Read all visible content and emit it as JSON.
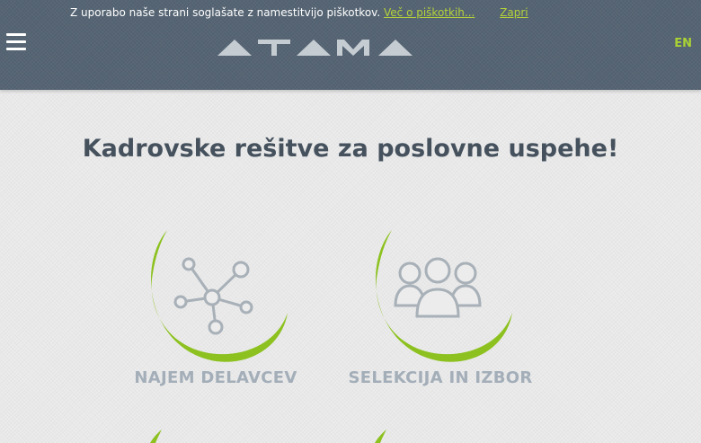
{
  "cookie_bar": {
    "text": "Z uporabo naše strani soglašate z namestitvijo piškotkov.",
    "more_link": "Več o piškotkih...",
    "close_link": "Zapri"
  },
  "header": {
    "lang": "EN",
    "logo_alt": "ATAMA"
  },
  "main": {
    "headline": "Kadrovske rešitve za poslovne uspehe!"
  },
  "services": [
    {
      "label": "NAJEM DELAVCEV",
      "icon": "network-icon"
    },
    {
      "label": "SELEKCIJA IN IZBOR",
      "icon": "people-group-icon"
    }
  ],
  "colors": {
    "header_bg": "#526170",
    "accent_green": "#8cc11f",
    "link_green": "#b4d23a",
    "icon_gray": "#a8b0b8",
    "label_gray": "#a3aeb9",
    "headline": "#45515d"
  }
}
